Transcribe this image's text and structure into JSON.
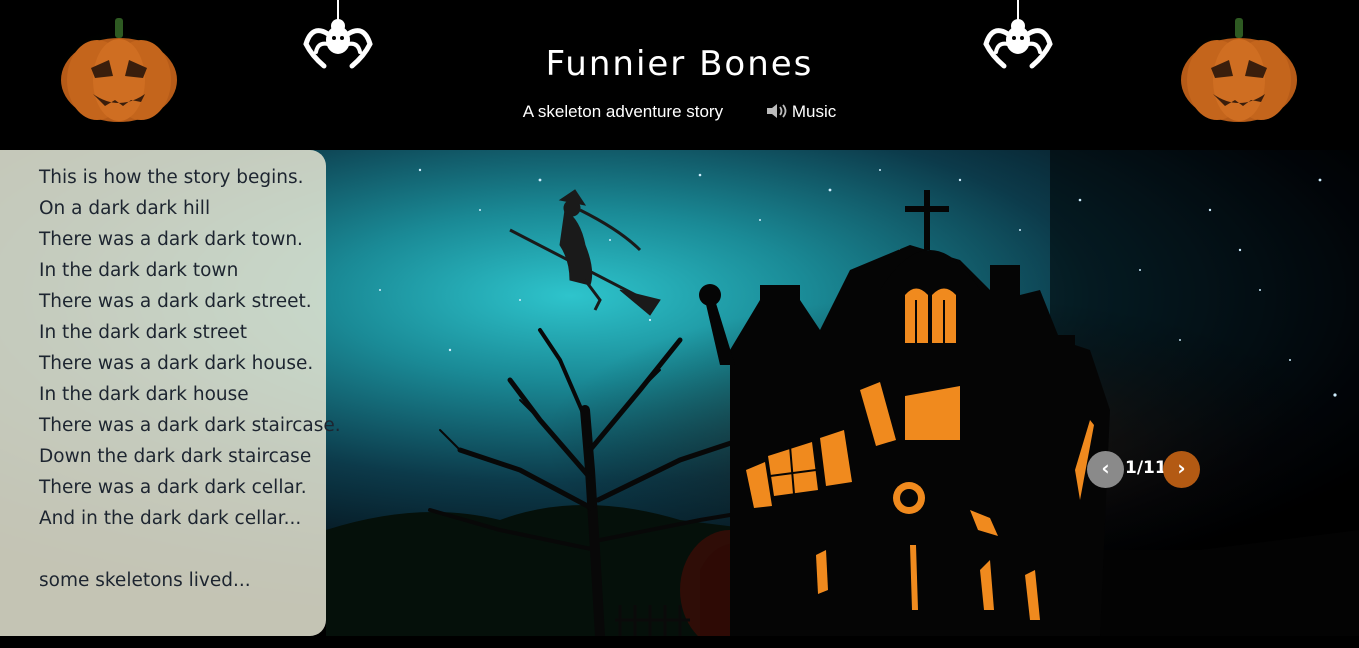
{
  "header": {
    "title": "Funnier Bones",
    "subtitle": "A skeleton adventure story",
    "music_label": "Music"
  },
  "icons": {
    "pumpkin_left": "jack-o-lantern-icon",
    "pumpkin_right": "jack-o-lantern-icon",
    "spider_left": "spider-icon",
    "spider_right": "spider-icon",
    "speaker": "speaker-icon",
    "prev": "chevron-left-icon",
    "next": "chevron-right-icon"
  },
  "story": {
    "lines": [
      "This is how the story begins.",
      "On a dark dark hill",
      "There was a dark dark town.",
      "In the dark dark town",
      "There was a dark dark street.",
      "In the dark dark street",
      "There was a dark dark house.",
      "In the dark dark house",
      "There was a dark dark staircase.",
      "Down the dark dark staircase",
      "There was a dark dark cellar.",
      "And in the dark dark cellar...",
      "",
      "some skeletons lived..."
    ]
  },
  "navigation": {
    "prev_label": "‹",
    "next_label": "›",
    "counter": "1/11"
  },
  "colors": {
    "background": "#000000",
    "panel": "#e4e4d2",
    "next_button": "#b35a13",
    "prev_button": "#8a8a8a",
    "pumpkin": "#c9651b"
  }
}
